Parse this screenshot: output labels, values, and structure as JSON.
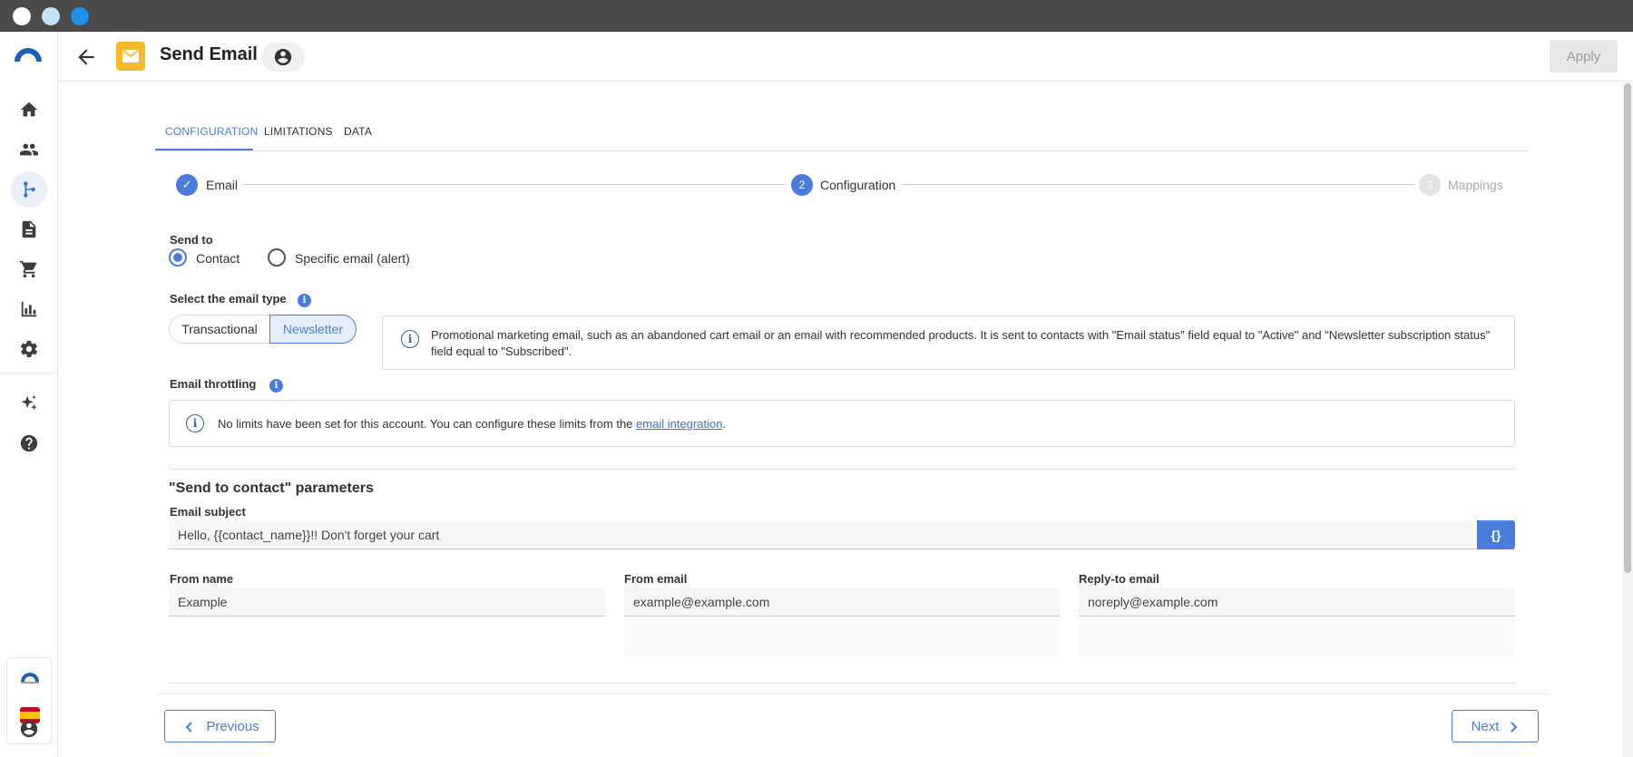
{
  "window": {
    "dots": [
      "#ffffff",
      "#c5e1f5",
      "#1e90ee"
    ]
  },
  "header": {
    "title": "Send Email",
    "apply_label": "Apply"
  },
  "tabs": [
    {
      "label": "CONFIGURATION",
      "active": true
    },
    {
      "label": "LIMITATIONS",
      "active": false
    },
    {
      "label": "DATA",
      "active": false
    }
  ],
  "stepper": [
    {
      "label": "Email",
      "marker": "✓",
      "state": "done"
    },
    {
      "label": "Configuration",
      "marker": "2",
      "state": "active"
    },
    {
      "label": "Mappings",
      "marker": "3",
      "state": "pending"
    }
  ],
  "send_to": {
    "label": "Send to",
    "options": [
      "Contact",
      "Specific email (alert)"
    ],
    "selected": "Contact"
  },
  "email_type": {
    "label": "Select the email type",
    "options": [
      "Transactional",
      "Newsletter"
    ],
    "selected": "Newsletter",
    "description": "Promotional marketing email, such as an abandoned cart email or an email with recommended products. It is sent to contacts with \"Email status\" field equal to \"Active\" and \"Newsletter subscription status\" field equal to \"Subscribed\"."
  },
  "throttling": {
    "label": "Email throttling",
    "message_prefix": "No limits have been set for this account. You can configure these limits from the ",
    "link": "email integration",
    "message_suffix": "."
  },
  "contact_params": {
    "heading": "\"Send to contact\" parameters",
    "subject_label": "Email subject",
    "subject_value": "Hello, {{contact_name}}!! Don't forget your cart",
    "variables_button": "{}",
    "from_name_label": "From name",
    "from_name_value": "Example",
    "from_email_label": "From email",
    "from_email_value": "example@example.com",
    "reply_to_label": "Reply-to email",
    "reply_to_value": "noreply@example.com"
  },
  "footer": {
    "previous_label": "Previous",
    "next_label": "Next"
  },
  "colors": {
    "accent": "#4a7ddb",
    "header_icon_bg": "#f7b92b",
    "logo": "#1f5fb3",
    "titlebar": "#4a4a4a"
  }
}
